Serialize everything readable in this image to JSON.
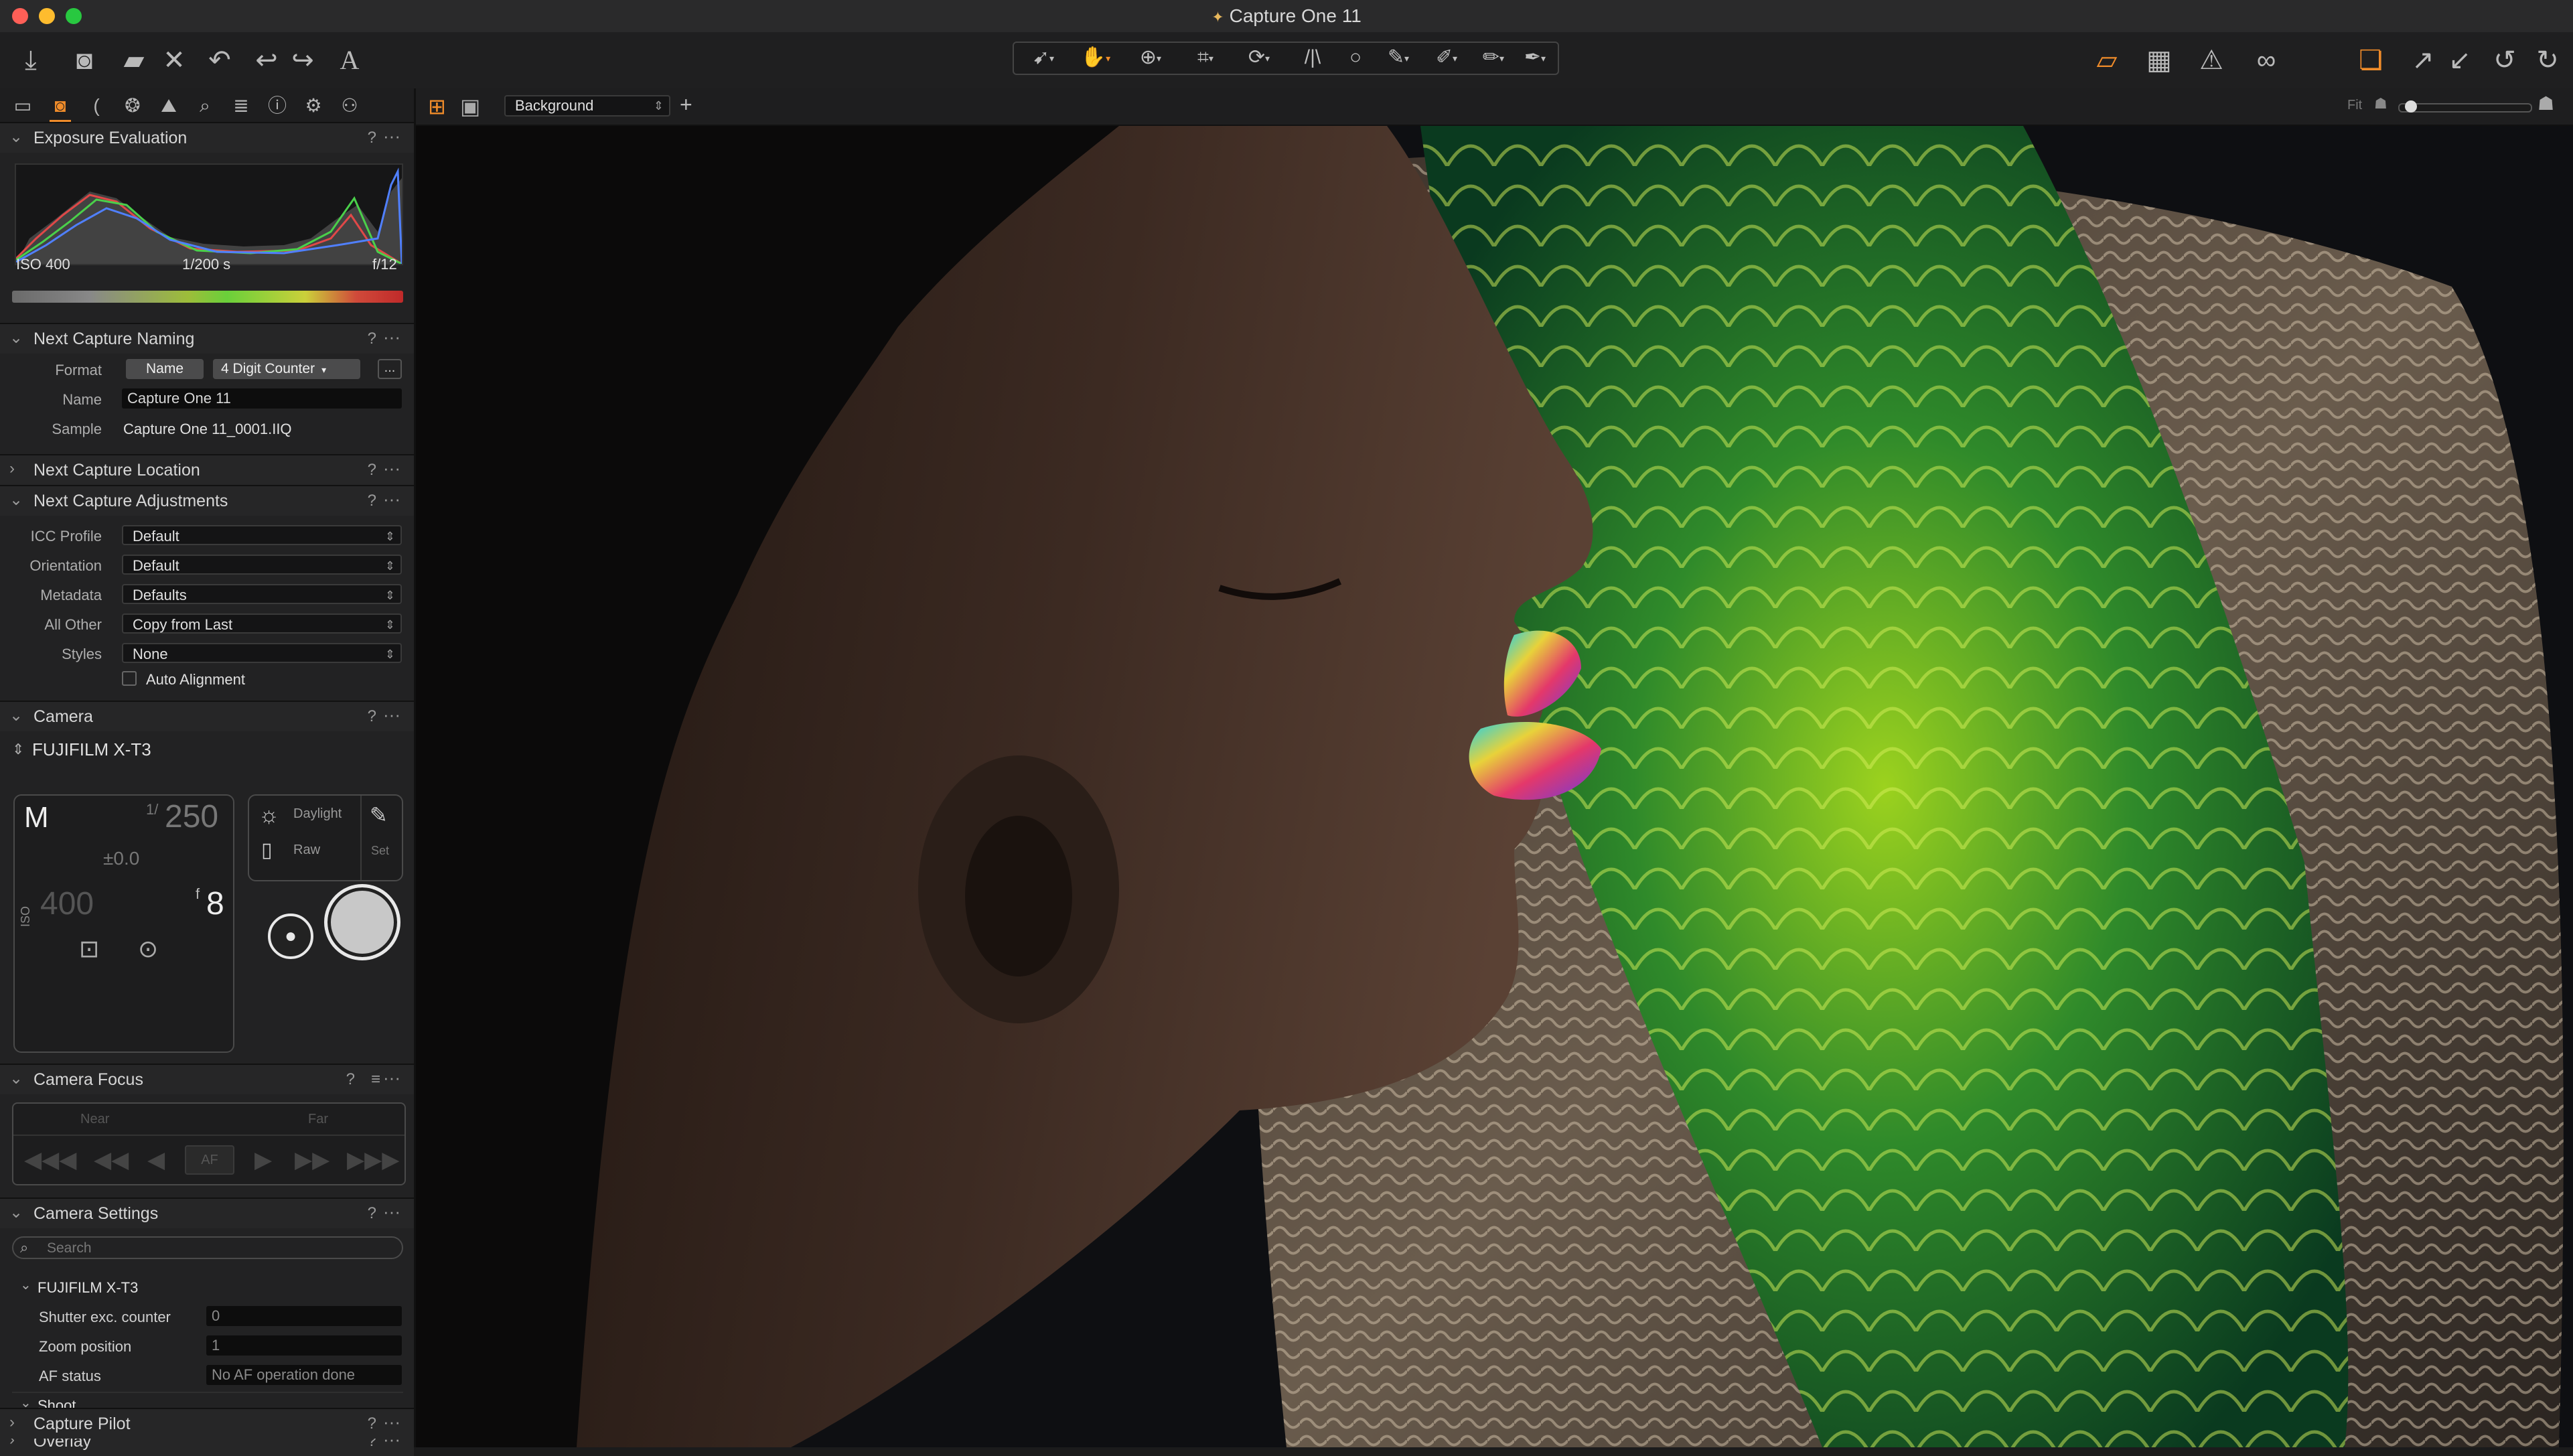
{
  "window": {
    "title": "Capture One 11"
  },
  "viewer_bar": {
    "variant_select": "Background",
    "zoom_label": "Fit"
  },
  "panels": {
    "exposure": {
      "title": "Exposure Evaluation",
      "iso": "ISO 400",
      "shutter": "1/200 s",
      "aperture": "f/12"
    },
    "naming": {
      "title": "Next Capture Naming",
      "format_label": "Format",
      "format_token_1": "Name",
      "format_token_2": "4 Digit Counter",
      "more_button": "...",
      "name_label": "Name",
      "name_value": "Capture One 11",
      "sample_label": "Sample",
      "sample_value": "Capture One 11_0001.IIQ"
    },
    "location": {
      "title": "Next Capture Location"
    },
    "adjustments": {
      "title": "Next Capture Adjustments",
      "rows": [
        {
          "label": "ICC Profile",
          "value": "Default"
        },
        {
          "label": "Orientation",
          "value": "Default"
        },
        {
          "label": "Metadata",
          "value": "Defaults"
        },
        {
          "label": "All Other",
          "value": "Copy from Last"
        },
        {
          "label": "Styles",
          "value": "None"
        }
      ],
      "auto_alignment": "Auto Alignment"
    },
    "camera": {
      "title": "Camera",
      "model": "FUJIFILM X-T3",
      "mode": "M",
      "shutter_prefix": "1/",
      "shutter": "250",
      "ev": "±0.0",
      "iso_label": "ISO",
      "iso": "400",
      "aperture_prefix": "f",
      "aperture": "8",
      "wb": "Daylight",
      "format": "Raw",
      "set": "Set"
    },
    "focus": {
      "title": "Camera Focus",
      "near": "Near",
      "far": "Far",
      "af": "AF"
    },
    "settings": {
      "title": "Camera Settings",
      "search_placeholder": "Search",
      "group": "FUJIFILM X-T3",
      "rows": [
        {
          "label": "Shutter exc. counter",
          "value": "0"
        },
        {
          "label": "Zoom position",
          "value": "1"
        },
        {
          "label": "AF status",
          "value": "No AF operation done"
        }
      ],
      "subgroup": "Shoot"
    },
    "overlay": {
      "title": "Overlay"
    },
    "pilot": {
      "title": "Capture Pilot"
    }
  },
  "colors": {
    "accent": "#f08c2a",
    "panel_bg": "#222223",
    "viewer_bg": "#0f1012"
  }
}
